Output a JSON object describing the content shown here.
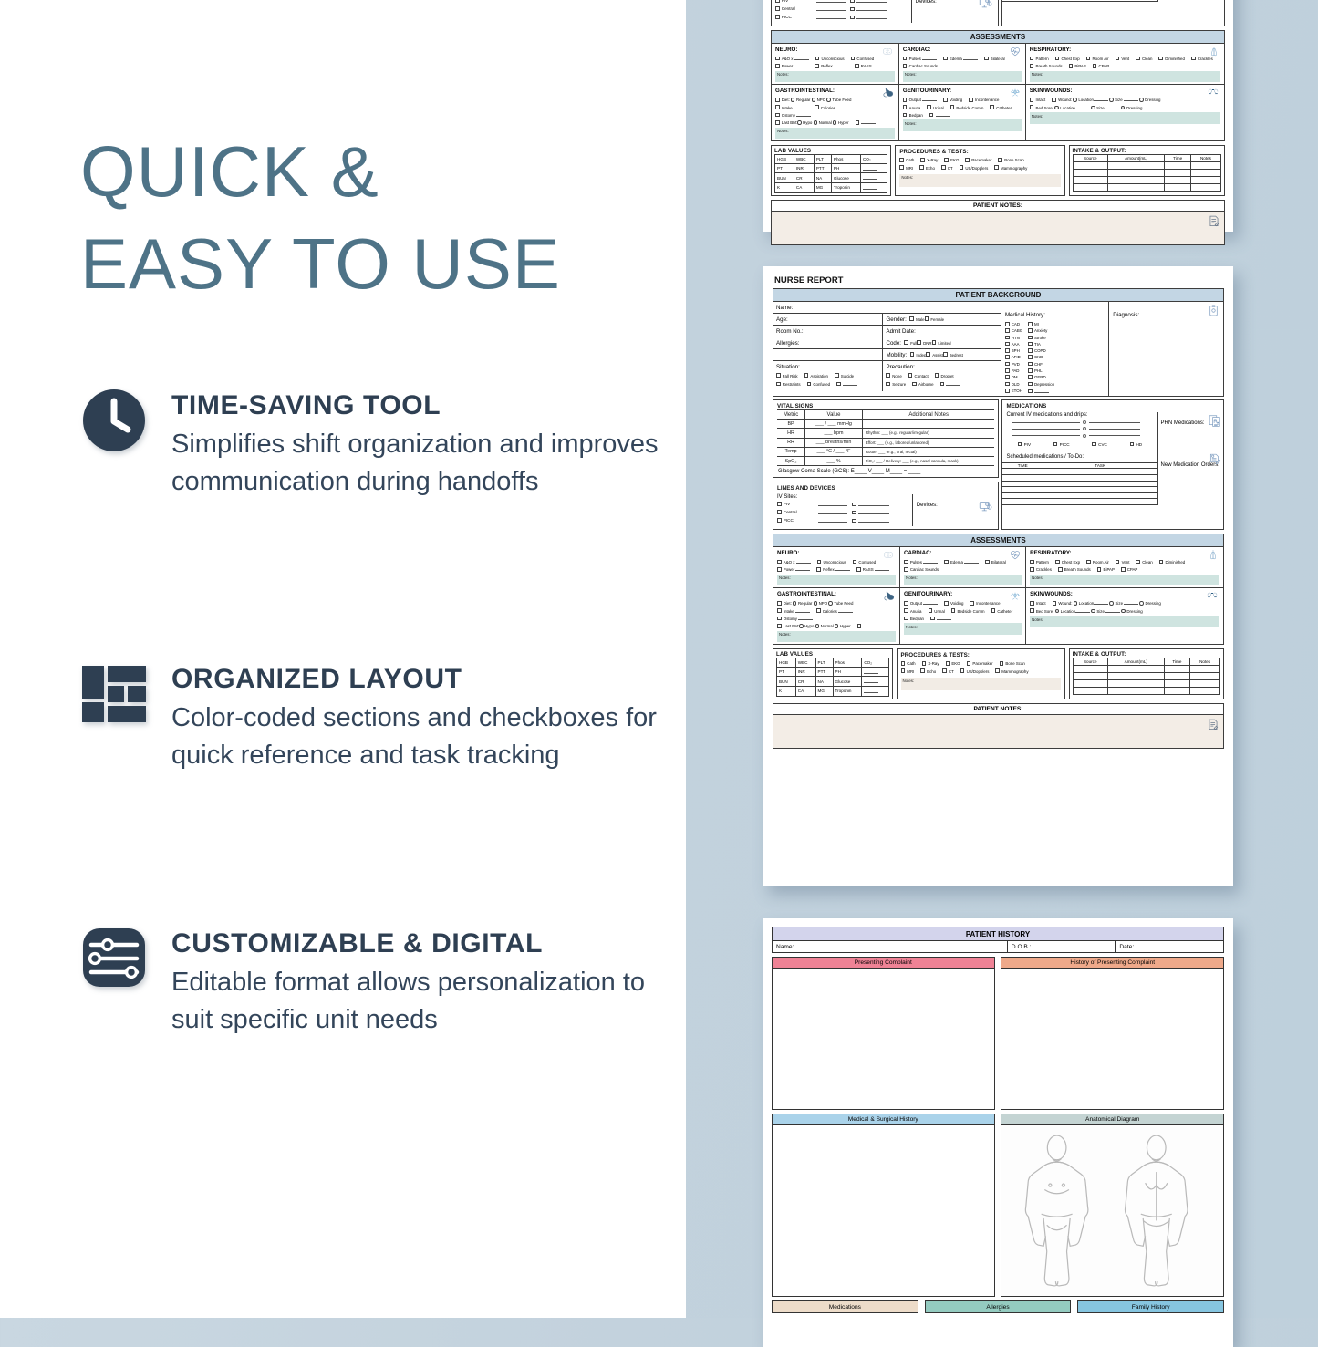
{
  "headline": {
    "line1": "QUICK &",
    "line2": "EASY TO USE"
  },
  "features": [
    {
      "icon": "clock-icon",
      "title": "TIME-SAVING TOOL",
      "desc": "Simplifies shift organization and improves communication during handoffs"
    },
    {
      "icon": "layout-grid-icon",
      "title": "ORGANIZED LAYOUT",
      "desc": "Color-coded sections and checkboxes for quick reference and task tracking"
    },
    {
      "icon": "sliders-icon",
      "title": "CUSTOMIZABLE & DIGITAL",
      "desc": "Editable format allows personalization to suit specific unit needs"
    }
  ],
  "colors": {
    "background": "#c3d2dd",
    "headline": "#4e7387",
    "feature_title": "#2e3f52",
    "icon_navy": "#2e3f52",
    "band_blue": "#c3d6e4",
    "notes_teal": "#cfe4e0",
    "notes_beige": "#f2ece5",
    "history_band": "#d3d4ec",
    "presenting_complaint": "#ef8295",
    "history_complaint": "#efa98a",
    "medsurg_history": "#aad3ea",
    "anatomical": "#c4d4d3",
    "medications_tab": "#eddcc9",
    "allergies_tab": "#94cbc0",
    "family_tab": "#86c5e0"
  },
  "nurse_report": {
    "title": "NURSE REPORT",
    "patient_background": {
      "band": "PATIENT BACKGROUND",
      "left_fields": [
        "Name:",
        "Age:",
        "Room No.:",
        "Allergies:"
      ],
      "right_fields": [
        {
          "label": "Gender:",
          "options": [
            "Male",
            "Female"
          ]
        },
        {
          "label": "Admit Date:",
          "options": []
        },
        {
          "label": "Code:",
          "options": [
            "Full",
            "DNR",
            "Limited"
          ]
        },
        {
          "label": "Mobility:",
          "options": [
            "Indep",
            "Assist",
            "Bedrest"
          ]
        }
      ],
      "situation": {
        "label": "Situation:",
        "options": [
          "Fall Risk",
          "Aspiration",
          "Suicide",
          "Restraints",
          "Confused",
          "____"
        ]
      },
      "precaution": {
        "label": "Precaution:",
        "options": [
          "None",
          "Contact",
          "Droplet",
          "Seizure",
          "Airborne",
          "____"
        ]
      },
      "medical_history": {
        "label": "Medical History:",
        "col1": [
          "CAD",
          "CABG",
          "HTN",
          "AAA",
          "BPH",
          "AFID",
          "PVD",
          "PAD",
          "DM",
          "DLD",
          "ETOH"
        ],
        "col2": [
          "MI",
          "Anxiety",
          "Stroke",
          "TIA",
          "COPD",
          "CKD",
          "CHF",
          "PHL",
          "GERD",
          "Depression",
          "____"
        ]
      },
      "diagnosis": {
        "label": "Diagnosis:",
        "icon": "clipboard-icon"
      }
    },
    "vital_signs": {
      "title": "VITAL SIGNS",
      "headers": [
        "Metric",
        "Value",
        "Additional Notes"
      ],
      "rows": [
        {
          "metric": "BP",
          "value": "___ / ___ mmHg",
          "notes": ""
        },
        {
          "metric": "HR",
          "value": "___ bpm",
          "notes": "Rhythm: ___ (e.g., regular/irregular)"
        },
        {
          "metric": "RR",
          "value": "___ breaths/min",
          "notes": "Effort: ___ (e.g., labored/unlabored)"
        },
        {
          "metric": "Temp",
          "value": "___ °C / ___ °F",
          "notes": "Route: ___ (e.g., oral, rectal)"
        },
        {
          "metric": "SpO₂",
          "value": "___ %",
          "notes": "FiO₂: ___ / Delivery: ___ (e.g., nasal cannula, mask)"
        }
      ],
      "gcs": "Glasgow Coma Scale (GCS): E____  V____  M____ = ____"
    },
    "lines_devices": {
      "title": "LINES AND DEVICES",
      "iv_label": "IV Sites:",
      "iv_options": [
        "PIV",
        "Central",
        "PICC"
      ],
      "devices_label": "Devices:",
      "devices_icon": "monitor-icon"
    },
    "medications": {
      "title": "MEDICATIONS",
      "iv_label": "Current IV medications and drips:",
      "access_options": [
        "PIV",
        "PICC",
        "CVC",
        "HD"
      ],
      "prn_label": "PRN Medications:",
      "prn_icon": "prescription-icon",
      "scheduled_label": "Scheduled medications / To-Do:",
      "todo_headers": [
        "TIME",
        "TASK"
      ],
      "new_orders_label": "New Medication Orders:",
      "new_orders_icon": "document-edit-icon"
    },
    "assessments": {
      "band": "ASSESSMENTS",
      "notes_label": "Notes:",
      "cells": [
        {
          "title": "NEURO:",
          "icon": "brain-icon",
          "options": [
            "A&O x ____",
            "Unconscious",
            "Confused",
            "Power ____",
            "Reflex ____",
            "RASS ____"
          ]
        },
        {
          "title": "CARDIAC:",
          "icon": "heart-icon",
          "options": [
            "Pulses ____",
            "Edema ____",
            "Bilateral",
            "Cardiac Sounds"
          ]
        },
        {
          "title": "RESPIRATORY:",
          "icon": "lungs-icon",
          "options": [
            "Pattern",
            "Chest Exp",
            "Room Air",
            "Vent",
            "Clean",
            "Diminished",
            "Crackles",
            "Breath Sounds",
            "BiPAP",
            "CPAP"
          ]
        },
        {
          "title": "GASTROINTESTINAL:",
          "icon": "stomach-icon",
          "options": [
            "Diet: ○Regular ○NPO ○Tube Feed",
            "Intake ____",
            "Calories ____",
            "Ostomy ____",
            "Last BM:○Hypo ○Normal ○Hyper",
            "____"
          ]
        },
        {
          "title": "GENITOURINARY:",
          "icon": "kidney-icon",
          "options": [
            "Output ____",
            "Voiding",
            "Incontenance",
            "Anuria",
            "Urinal",
            "Bedside Comm",
            "Catheter",
            "Bedpan",
            "____"
          ]
        },
        {
          "title": "SKIN/WOUNDS:",
          "icon": "skin-icon",
          "options": [
            "Intact",
            "Wound: ○Location____ ○Size ____ ○Dressing",
            "Bed Sore: ○Location____ ○Size ____ ○Dressing"
          ]
        }
      ]
    },
    "lab_values": {
      "title": "LAB VALUES",
      "rows": [
        [
          "HGB",
          "WBC",
          "PLT",
          "Phos",
          "CO₂"
        ],
        [
          "PT",
          "INR",
          "PTT",
          "PH",
          "____"
        ],
        [
          "BUN",
          "CR",
          "NA",
          "Glucose",
          "____"
        ],
        [
          "K",
          "CA",
          "MG",
          "Troponin",
          "____"
        ]
      ]
    },
    "procedures": {
      "title": "PROCEDURES & TESTS:",
      "row1": [
        "Cath",
        "X-Ray",
        "EKG",
        "Pacemaker",
        "Bone Scan"
      ],
      "row2": [
        "MRI",
        "Echo",
        "CT",
        "US/Dopplers",
        "Mammography"
      ],
      "notes_label": "Notes:"
    },
    "intake_output": {
      "title": "INTAKE & OUTPUT:",
      "headers": [
        "Source",
        "Amount(mL)",
        "Time",
        "Notes"
      ],
      "row_count": 4
    },
    "patient_notes": {
      "band": "PATIENT NOTES:",
      "icon": "note-icon"
    }
  },
  "patient_history": {
    "band": "PATIENT HISTORY",
    "fields": [
      "Name:",
      "D.O.B.:",
      "Date:"
    ],
    "sections": [
      {
        "title": "Presenting Complaint",
        "color": "#ef8295"
      },
      {
        "title": "History of Presenting Complaint",
        "color": "#efa98a"
      },
      {
        "title": "Medical & Surgical History",
        "color": "#aad3ea"
      },
      {
        "title": "Anatomical Diagram",
        "color": "#c4d4d3"
      }
    ],
    "footer_tabs": [
      {
        "label": "Medications",
        "color": "#eddcc9"
      },
      {
        "label": "Allergies",
        "color": "#94cbc0"
      },
      {
        "label": "Family History",
        "color": "#86c5e0"
      }
    ]
  }
}
